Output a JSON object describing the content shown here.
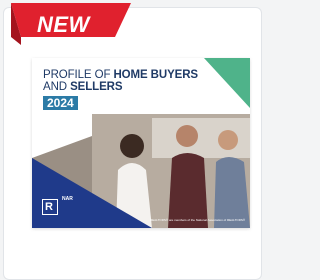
{
  "badge": {
    "label": "NEW",
    "color": "#e0212e"
  },
  "cover": {
    "title_line1_pre": "PROFILE OF ",
    "title_line1_bold": "HOME BUYERS",
    "title_line2_pre": "AND ",
    "title_line2_bold": "SELLERS",
    "year": "2024",
    "logo_letter": "R",
    "logo_text": "NAR",
    "footer_note": "REALTORS® are members of the National Association of REALTORS®",
    "accent_green": "#4fb38a",
    "accent_navy": "#1f3a8a",
    "title_color": "#1f3a66",
    "year_bg": "#2c7ba6"
  }
}
